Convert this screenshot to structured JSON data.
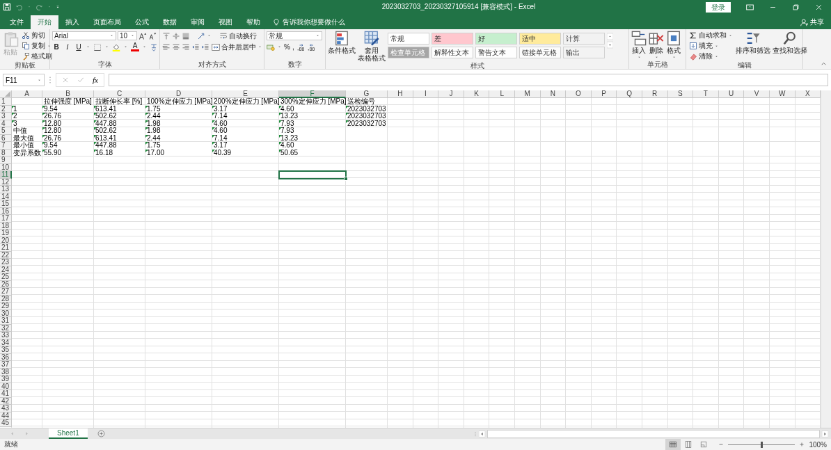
{
  "title_bar": {
    "title": "2023032703_20230327105914  [兼容模式]  -  Excel",
    "login": "登录"
  },
  "menu_tabs": [
    {
      "label": "文件",
      "selected": false
    },
    {
      "label": "开始",
      "selected": true
    },
    {
      "label": "插入",
      "selected": false
    },
    {
      "label": "页面布局",
      "selected": false
    },
    {
      "label": "公式",
      "selected": false
    },
    {
      "label": "数据",
      "selected": false
    },
    {
      "label": "审阅",
      "selected": false
    },
    {
      "label": "视图",
      "selected": false
    },
    {
      "label": "帮助",
      "selected": false
    }
  ],
  "tell_me": "告诉我你想要做什么",
  "share": "共享",
  "ribbon": {
    "clipboard": {
      "label": "剪贴板",
      "paste": {
        "label": "粘贴",
        "disabled": true
      },
      "items": [
        {
          "kind": "cut",
          "label": "剪切"
        },
        {
          "kind": "copy",
          "label": "复制"
        },
        {
          "kind": "painter",
          "label": "格式刷"
        }
      ]
    },
    "font": {
      "label": "字体",
      "font_name": "Arial",
      "font_size": "10",
      "styles": [
        "B",
        "I",
        "U"
      ],
      "font_color": "A"
    },
    "alignment": {
      "label": "对齐方式",
      "wrap": "自动换行",
      "merge": "合并后居中"
    },
    "number": {
      "label": "数字",
      "format": "常规",
      "percent": "%",
      "comma": ","
    },
    "styles": {
      "label": "样式",
      "conditional": [
        "条件格式"
      ],
      "table_format": [
        "套用",
        "表格格式"
      ],
      "gallery": [
        {
          "label": "常规",
          "color": "#ffffff"
        },
        {
          "label": "差",
          "color": "#ffc7ce"
        },
        {
          "label": "好",
          "color": "#c6efce"
        },
        {
          "label": "适中",
          "color": "#ffeb9c"
        },
        {
          "label": "计算",
          "color": "#f2f2f2"
        },
        {
          "label": "检查单元格",
          "color": "#a5a5a5"
        },
        {
          "label": "解释性文本",
          "color": "#fdfdfd"
        },
        {
          "label": "警告文本",
          "color": "#fefefe"
        },
        {
          "label": "链接单元格",
          "color": "#fcfcfc"
        },
        {
          "label": "输出",
          "color": "#f3f3f3"
        }
      ]
    },
    "cells": {
      "label": "单元格",
      "items": [
        {
          "kind": "insert",
          "label": "插入"
        },
        {
          "kind": "delete",
          "label": "删除"
        },
        {
          "kind": "format",
          "label": "格式"
        }
      ]
    },
    "editing": {
      "label": "编辑",
      "items": [
        {
          "kind": "sum",
          "label": "自动求和"
        },
        {
          "kind": "fill",
          "label": "填充"
        },
        {
          "kind": "clear",
          "label": "清除"
        }
      ],
      "big": [
        {
          "kind": "sort",
          "label": "排序和筛选"
        },
        {
          "kind": "find",
          "label": "查找和选择"
        }
      ]
    }
  },
  "formula_bar": {
    "name_box": "F11",
    "fx": "fx"
  },
  "grid": {
    "columns": [
      {
        "label": "A",
        "selected": false
      },
      {
        "label": "B",
        "selected": false
      },
      {
        "label": "C",
        "selected": false
      },
      {
        "label": "D",
        "selected": false
      },
      {
        "label": "E",
        "selected": false
      },
      {
        "label": "F",
        "selected": true
      },
      {
        "label": "G",
        "selected": false
      },
      {
        "label": "H",
        "selected": false
      },
      {
        "label": "I",
        "selected": false
      },
      {
        "label": "J",
        "selected": false
      },
      {
        "label": "K",
        "selected": false
      },
      {
        "label": "L",
        "selected": false
      },
      {
        "label": "M",
        "selected": false
      },
      {
        "label": "N",
        "selected": false
      },
      {
        "label": "O",
        "selected": false
      },
      {
        "label": "P",
        "selected": false
      },
      {
        "label": "Q",
        "selected": false
      },
      {
        "label": "R",
        "selected": false
      },
      {
        "label": "S",
        "selected": false
      },
      {
        "label": "T",
        "selected": false
      },
      {
        "label": "U",
        "selected": false
      },
      {
        "label": "V",
        "selected": false
      },
      {
        "label": "W",
        "selected": false
      },
      {
        "label": "X",
        "selected": false
      }
    ],
    "rows": [
      {
        "number": "1",
        "selected": false,
        "cells": [
          {},
          {
            "text": "拉伸强度 [MPa]",
            "warn": false
          },
          {
            "text": "拉断伸长率 [%]",
            "warn": false
          },
          {
            "text": "100%定伸应力 [MPa]",
            "warn": false
          },
          {
            "text": "200%定伸应力 [MPa]",
            "warn": false
          },
          {
            "text": "300%定伸应力 [MPa]",
            "warn": false
          },
          {
            "text": "送检编号",
            "warn": false
          }
        ]
      },
      {
        "number": "2",
        "selected": false,
        "cells": [
          {
            "text": "1",
            "warn": true
          },
          {
            "text": "9.54",
            "warn": true
          },
          {
            "text": "613.41",
            "warn": true
          },
          {
            "text": "1.75",
            "warn": true
          },
          {
            "text": "3.17",
            "warn": true
          },
          {
            "text": "4.60",
            "warn": true
          },
          {
            "text": "2023032703",
            "warn": true
          }
        ]
      },
      {
        "number": "3",
        "selected": false,
        "cells": [
          {
            "text": "2",
            "warn": true
          },
          {
            "text": "26.76",
            "warn": true
          },
          {
            "text": "502.62",
            "warn": true
          },
          {
            "text": "2.44",
            "warn": true
          },
          {
            "text": "7.14",
            "warn": true
          },
          {
            "text": "13.23",
            "warn": true
          },
          {
            "text": "2023032703",
            "warn": true
          }
        ]
      },
      {
        "number": "4",
        "selected": false,
        "cells": [
          {
            "text": "3",
            "warn": true
          },
          {
            "text": "12.80",
            "warn": true
          },
          {
            "text": "447.88",
            "warn": true
          },
          {
            "text": "1.98",
            "warn": true
          },
          {
            "text": "4.60",
            "warn": true
          },
          {
            "text": "7.93",
            "warn": true
          },
          {
            "text": "2023032703",
            "warn": true
          }
        ]
      },
      {
        "number": "5",
        "selected": false,
        "cells": [
          {
            "text": "中值",
            "warn": false
          },
          {
            "text": "12.80",
            "warn": true
          },
          {
            "text": "502.62",
            "warn": true
          },
          {
            "text": "1.98",
            "warn": true
          },
          {
            "text": "4.60",
            "warn": true
          },
          {
            "text": "7.93",
            "warn": true
          }
        ]
      },
      {
        "number": "6",
        "selected": false,
        "cells": [
          {
            "text": "最大值",
            "warn": false
          },
          {
            "text": "26.76",
            "warn": true
          },
          {
            "text": "613.41",
            "warn": true
          },
          {
            "text": "2.44",
            "warn": true
          },
          {
            "text": "7.14",
            "warn": true
          },
          {
            "text": "13.23",
            "warn": true
          }
        ]
      },
      {
        "number": "7",
        "selected": false,
        "cells": [
          {
            "text": "最小值",
            "warn": false
          },
          {
            "text": "9.54",
            "warn": true
          },
          {
            "text": "447.88",
            "warn": true
          },
          {
            "text": "1.75",
            "warn": true
          },
          {
            "text": "3.17",
            "warn": true
          },
          {
            "text": "4.60",
            "warn": true
          }
        ]
      },
      {
        "number": "8",
        "selected": false,
        "cells": [
          {
            "text": "变异系数",
            "warn": false
          },
          {
            "text": "55.90",
            "warn": true
          },
          {
            "text": "16.18",
            "warn": true
          },
          {
            "text": "17.00",
            "warn": true
          },
          {
            "text": "40.39",
            "warn": true
          },
          {
            "text": "50.65",
            "warn": true
          }
        ]
      },
      {
        "number": "9",
        "selected": false
      },
      {
        "number": "10",
        "selected": false
      },
      {
        "number": "11",
        "selected": true
      },
      {
        "number": "12",
        "selected": false
      },
      {
        "number": "13",
        "selected": false
      },
      {
        "number": "14",
        "selected": false
      },
      {
        "number": "15",
        "selected": false
      },
      {
        "number": "16",
        "selected": false
      },
      {
        "number": "17",
        "selected": false
      },
      {
        "number": "18",
        "selected": false
      },
      {
        "number": "19",
        "selected": false
      },
      {
        "number": "20",
        "selected": false
      },
      {
        "number": "21",
        "selected": false
      },
      {
        "number": "22",
        "selected": false
      },
      {
        "number": "23",
        "selected": false
      },
      {
        "number": "24",
        "selected": false
      },
      {
        "number": "25",
        "selected": false
      },
      {
        "number": "26",
        "selected": false
      },
      {
        "number": "27",
        "selected": false
      },
      {
        "number": "28",
        "selected": false
      },
      {
        "number": "29",
        "selected": false
      },
      {
        "number": "30",
        "selected": false
      },
      {
        "number": "31",
        "selected": false
      },
      {
        "number": "32",
        "selected": false
      },
      {
        "number": "33",
        "selected": false
      },
      {
        "number": "34",
        "selected": false
      },
      {
        "number": "35",
        "selected": false
      },
      {
        "number": "36",
        "selected": false
      },
      {
        "number": "37",
        "selected": false
      },
      {
        "number": "38",
        "selected": false
      },
      {
        "number": "39",
        "selected": false
      },
      {
        "number": "40",
        "selected": false
      },
      {
        "number": "41",
        "selected": false
      },
      {
        "number": "42",
        "selected": false
      },
      {
        "number": "43",
        "selected": false
      },
      {
        "number": "44",
        "selected": false
      },
      {
        "number": "45",
        "selected": false
      }
    ]
  },
  "sheet_tabs": [
    {
      "label": "Sheet1",
      "selected": true
    }
  ],
  "status_bar": {
    "text": "就绪",
    "views": [
      {
        "kind": "normal",
        "selected": true
      },
      {
        "kind": "page_layout",
        "selected": false
      },
      {
        "kind": "page_break",
        "selected": false
      }
    ],
    "zoom": {
      "level": 0.5,
      "reading": "100%"
    }
  }
}
